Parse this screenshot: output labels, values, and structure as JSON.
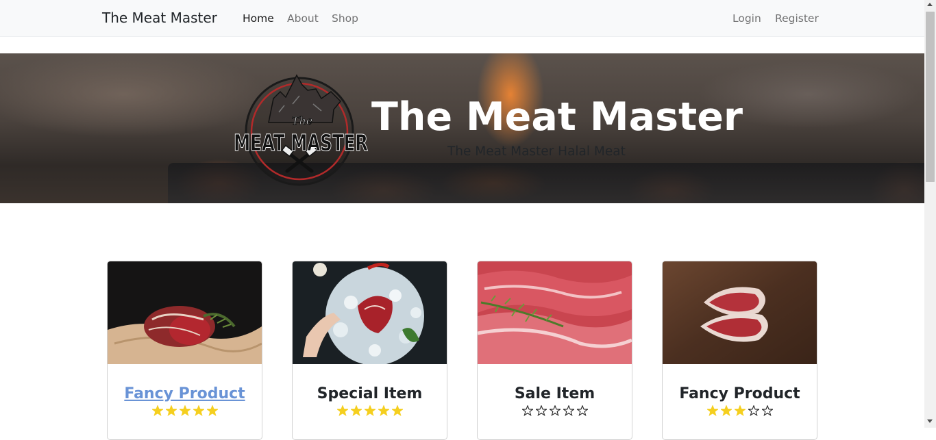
{
  "navbar": {
    "brand": "The Meat Master",
    "links": [
      {
        "label": "Home",
        "active": true
      },
      {
        "label": "About",
        "active": false
      },
      {
        "label": "Shop",
        "active": false
      }
    ],
    "auth": {
      "login": "Login",
      "register": "Register"
    }
  },
  "hero": {
    "title": "The Meat Master",
    "subtitle": "The Meat Master Halal Meat",
    "logo": {
      "line1": "The",
      "line2": "MEAT MASTER"
    }
  },
  "products": [
    {
      "title": "Fancy Product",
      "rating": 5,
      "image": "roast-beef-on-paper"
    },
    {
      "title": "Special Item",
      "rating": 5,
      "image": "steak-on-ice"
    },
    {
      "title": "Sale Item",
      "rating": 0,
      "image": "raw-steaks-with-rosemary"
    },
    {
      "title": "Fancy Product",
      "rating": 3,
      "image": "steaks-on-wood-board"
    }
  ],
  "colors": {
    "navbar_bg": "#f8f9fa",
    "star_filled": "#f5cf1f",
    "link": "#6993d6"
  }
}
